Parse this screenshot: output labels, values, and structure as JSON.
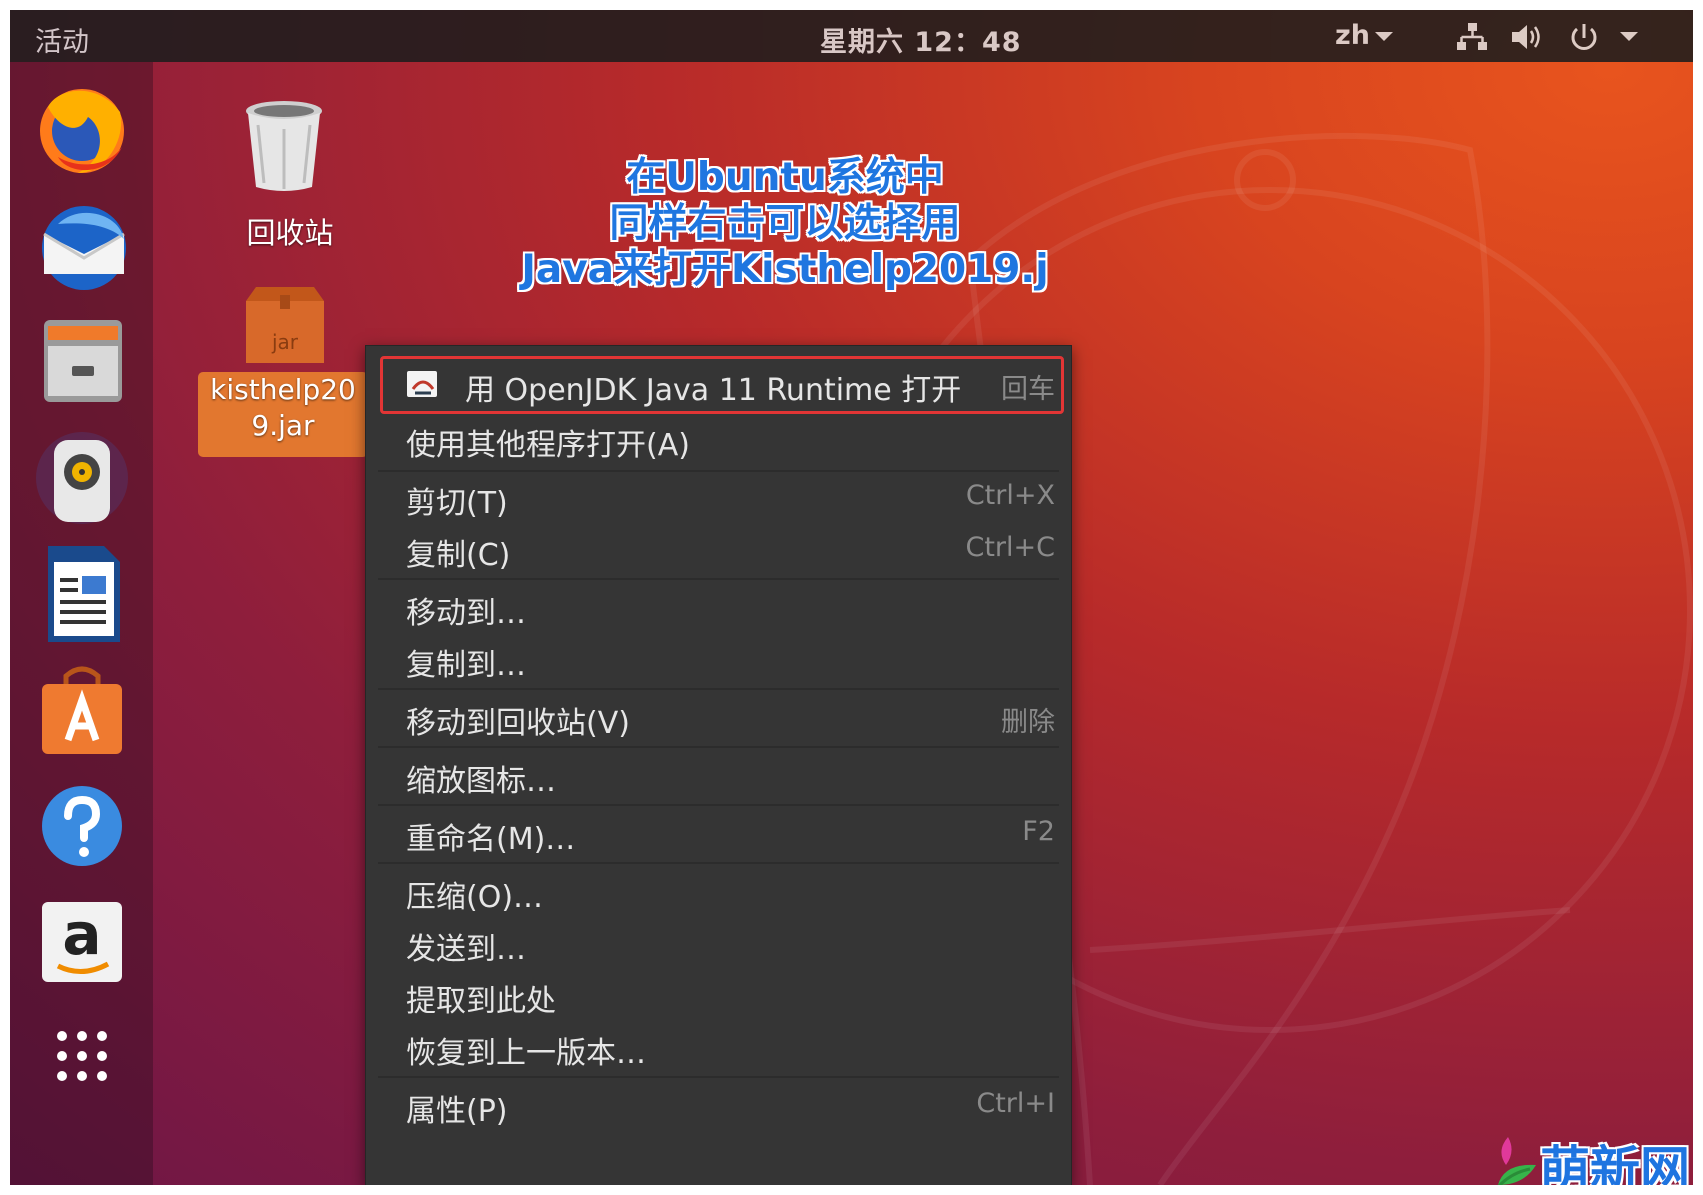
{
  "topbar": {
    "activities": "活动",
    "clock": "星期六 12：48",
    "language": "zh"
  },
  "desktop": {
    "trash_label": "回收站",
    "jar_badge": "jar",
    "jar_label_line1": "kisthelp20",
    "jar_label_line2": "9.jar"
  },
  "annotation": {
    "line1": "在Ubuntu系统中",
    "line2": "同样右击可以选择用",
    "line3": "Java来打开Kisthelp2019.j"
  },
  "menu": {
    "open_with_java": {
      "label": "用 OpenJDK Java 11 Runtime 打开",
      "shortcut": "回车"
    },
    "open_with_other": {
      "label": "使用其他程序打开(A)"
    },
    "cut": {
      "label": "剪切(T)",
      "shortcut": "Ctrl+X"
    },
    "copy": {
      "label": "复制(C)",
      "shortcut": "Ctrl+C"
    },
    "move_to": {
      "label": "移动到…"
    },
    "copy_to": {
      "label": "复制到…"
    },
    "move_to_trash": {
      "label": "移动到回收站(V)",
      "shortcut": "删除"
    },
    "resize_icon": {
      "label": "缩放图标…"
    },
    "rename": {
      "label": "重命名(M)…",
      "shortcut": "F2"
    },
    "compress": {
      "label": "压缩(O)…"
    },
    "send_to": {
      "label": "发送到…"
    },
    "extract_here": {
      "label": "提取到此处"
    },
    "revert": {
      "label": "恢复到上一版本…"
    },
    "properties": {
      "label": "属性(P)",
      "shortcut": "Ctrl+I"
    }
  },
  "dock": {
    "items": [
      "firefox-icon",
      "thunderbird-icon",
      "files-icon",
      "rhythmbox-icon",
      "libreoffice-writer-icon",
      "software-center-icon",
      "help-icon",
      "amazon-icon",
      "show-apps-icon"
    ]
  },
  "watermark": {
    "text": "萌新网"
  },
  "colors": {
    "menu_bg": "#353535",
    "highlight_border": "#e23535",
    "annotation_text": "#1f76e0",
    "jar_selected": "#e2772f"
  }
}
